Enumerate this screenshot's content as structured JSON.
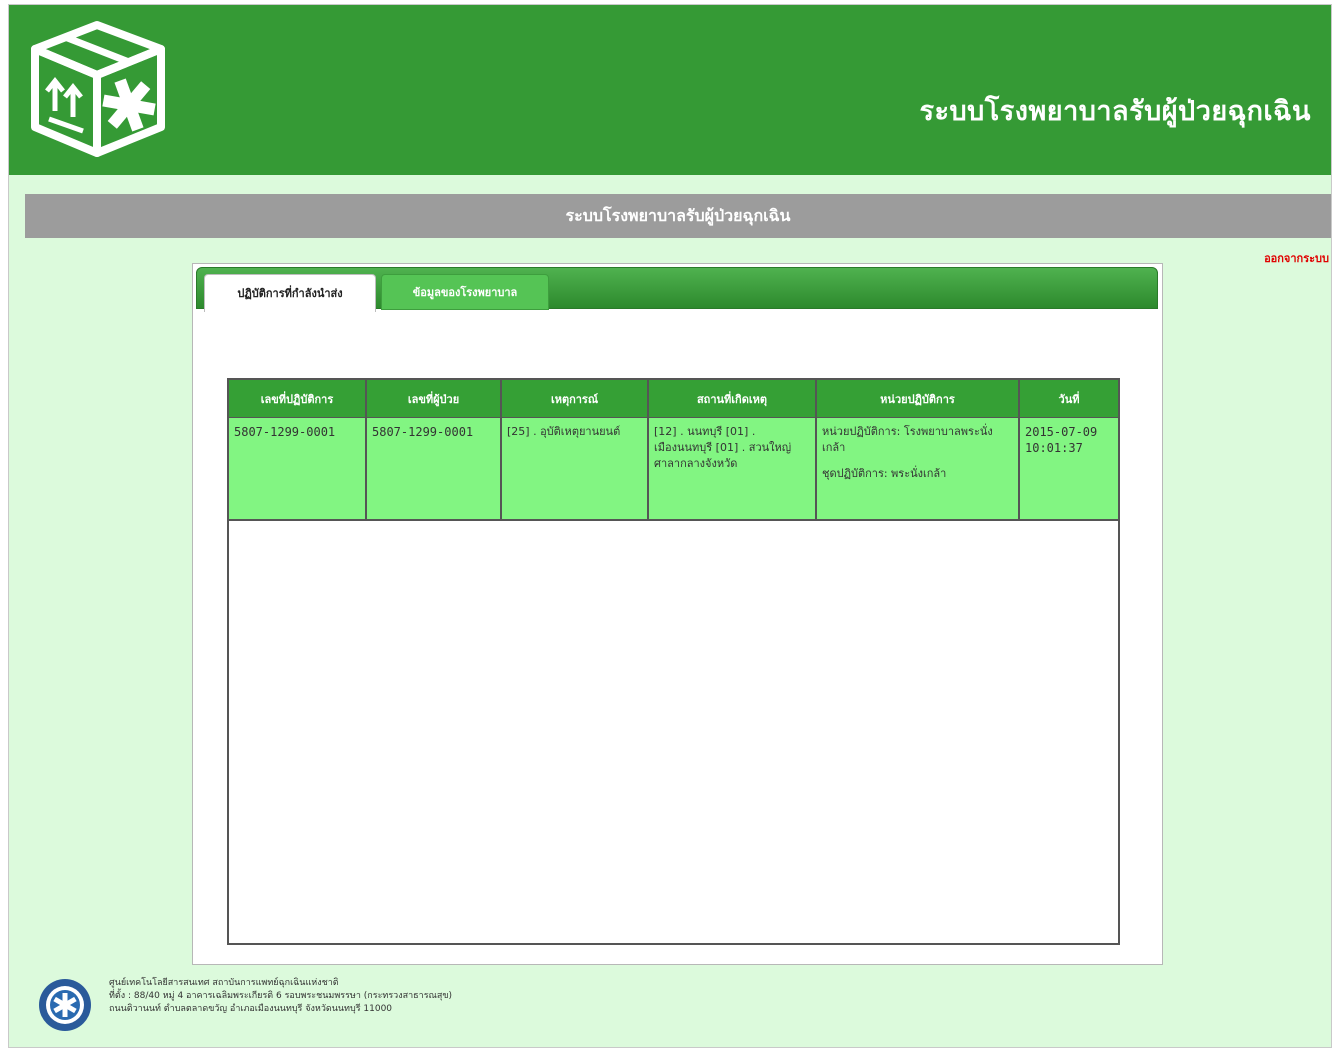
{
  "header": {
    "title": "ระบบโรงพยาบาลรับผู้ป่วยฉุกเฉิน",
    "logo_icon": "box-asterisk-logo-icon"
  },
  "subbar": {
    "title": "ระบบโรงพยาบาลรับผู้ป่วยฉุกเฉิน"
  },
  "logout": {
    "label": "ออกจากระบบ"
  },
  "tabs": [
    {
      "label": "ปฏิบัติการที่กำลังนำส่ง",
      "active": true
    },
    {
      "label": "ข้อมูลของโรงพยาบาล",
      "active": false
    }
  ],
  "table": {
    "headers": [
      "เลขที่ปฏิบัติการ",
      "เลขที่ผู้ป่วย",
      "เหตุการณ์",
      "สถานที่เกิดเหตุ",
      "หน่วยปฏิบัติการ",
      "วันที่"
    ],
    "rows": [
      {
        "operation_no": "5807-1299-0001",
        "patient_no": "5807-1299-0001",
        "incident": "[25] . อุบัติเหตุยานยนต์",
        "location": "[12] . นนทบุรี [01] . เมืองนนทบุรี [01] . สวนใหญ่ ศาลากลางจังหวัด",
        "unit_line1": "หน่วยปฏิบัติการ: โรงพยาบาลพระนั่งเกล้า",
        "unit_line2": "ชุดปฏิบัติการ: พระนั่งเกล้า",
        "date": "2015-07-09",
        "time": "10:01:37"
      }
    ]
  },
  "footer": {
    "line1": "ศูนย์เทคโนโลยีสารสนเทศ สถาบันการแพทย์ฉุกเฉินแห่งชาติ",
    "line2": "ที่ตั้ง : 88/40 หมู่ 4 อาคารเฉลิมพระเกียรติ 6 รอบพระชนมพรรษา (กระทรวงสาธารณสุข)",
    "line3": "ถนนติวานนท์ ตำบลตลาดขวัญ อำเภอเมืองนนทบุรี จังหวัดนนทบุรี 11000"
  },
  "colors": {
    "header": "#359a35",
    "background": "#dcfadc",
    "row": "#82f582",
    "logout": "#e00000"
  }
}
